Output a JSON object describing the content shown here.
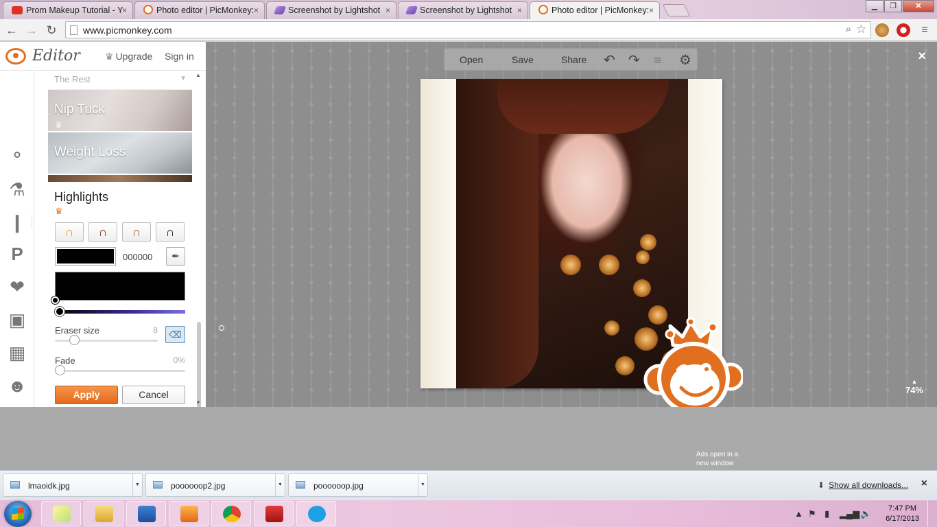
{
  "browser": {
    "tabs": [
      {
        "title": "Prom Makeup Tutorial - Y",
        "favicon": "youtube-icon"
      },
      {
        "title": "Photo editor | PicMonkey:",
        "favicon": "picmonkey-icon"
      },
      {
        "title": "Screenshot by Lightshot",
        "favicon": "lightshot-icon"
      },
      {
        "title": "Screenshot by Lightshot",
        "favicon": "lightshot-icon"
      },
      {
        "title": "Photo editor | PicMonkey:",
        "favicon": "picmonkey-icon"
      }
    ],
    "active_tab_index": 4,
    "url": "www.picmonkey.com",
    "close_glyph": "×"
  },
  "editor": {
    "logo_text": "Editor",
    "upgrade_label": "Upgrade",
    "signin_label": "Sign in",
    "rail_icons": [
      "basic-edits-icon",
      "effects-icon",
      "touch-up-icon",
      "text-icon",
      "overlays-icon",
      "frames-icon",
      "textures-icon",
      "themes-icon"
    ],
    "section_collapsed": "The Rest",
    "thumbs": [
      {
        "label": "Nip Tuck"
      },
      {
        "label": "Weight Loss"
      }
    ],
    "tool": {
      "title": "Highlights",
      "presets": [
        "preset-blonde",
        "preset-auburn",
        "preset-brown",
        "preset-black"
      ],
      "hex_value": "000000",
      "color": "#000000",
      "eraser_label": "Eraser size",
      "eraser_value": "8",
      "eraser_fraction": 0.14,
      "fade_label": "Fade",
      "fade_value": "0%",
      "fade_fraction": 0,
      "apply_label": "Apply",
      "cancel_label": "Cancel"
    }
  },
  "canvas": {
    "top_menu": {
      "open": "Open",
      "save": "Save",
      "share": "Share"
    },
    "zoom": "74%",
    "ads_note": "Ads open in a new window"
  },
  "downloads": {
    "items": [
      {
        "name": "lmaoidk.jpg"
      },
      {
        "name": "poooooop2.jpg"
      },
      {
        "name": "poooooop.jpg"
      }
    ],
    "show_all": "Show all downloads..."
  },
  "taskbar": {
    "apps": [
      "sticky-notes-app",
      "file-explorer-app",
      "word-app",
      "media-player-app",
      "chrome-app",
      "mcafee-app",
      "skype-app"
    ],
    "time": "7:47 PM",
    "date": "6/17/2013"
  },
  "colors": {
    "accent": "#e07020",
    "canvas_bg": "#8e8e8e"
  }
}
